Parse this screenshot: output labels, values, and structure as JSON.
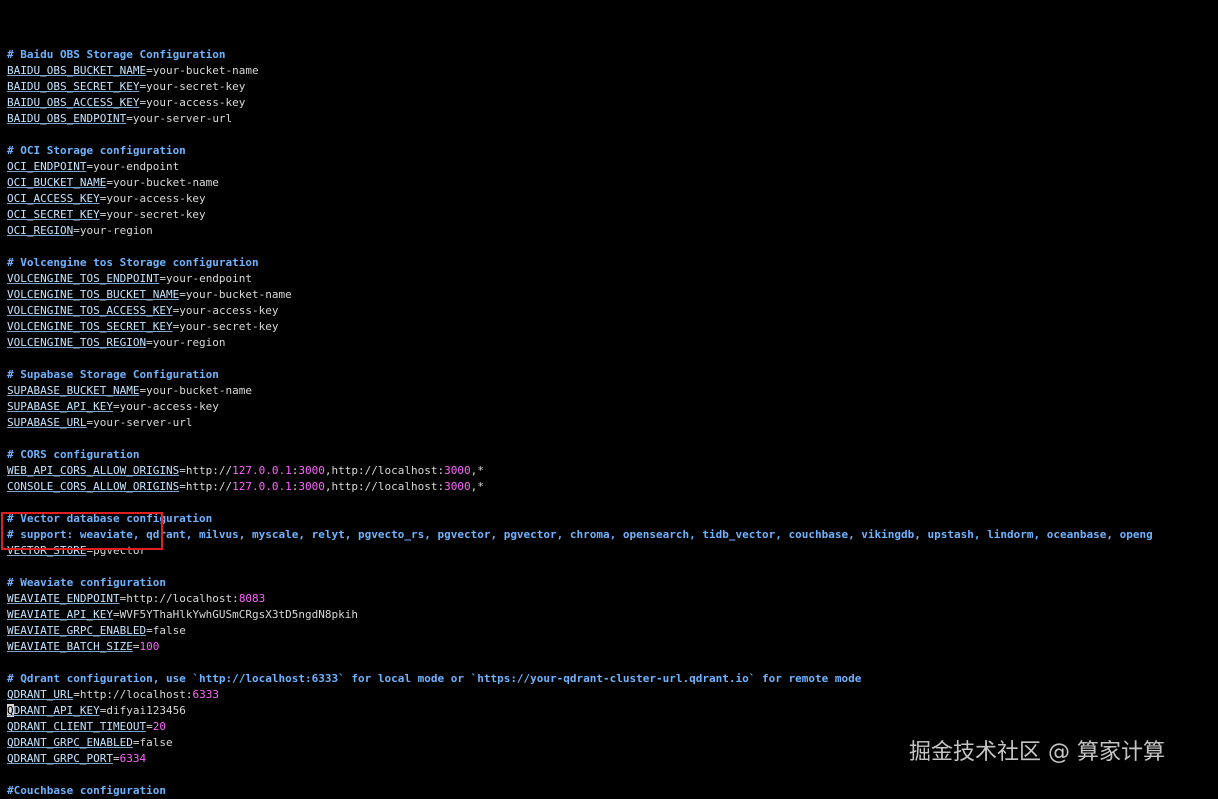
{
  "lines": [
    {
      "t": "blank"
    },
    {
      "t": "comment",
      "text": "# Baidu OBS Storage Configuration"
    },
    {
      "t": "kv",
      "key": "BAIDU_OBS_BUCKET_NAME",
      "parts": [
        {
          "v": "your-bucket-name"
        }
      ]
    },
    {
      "t": "kv",
      "key": "BAIDU_OBS_SECRET_KEY",
      "parts": [
        {
          "v": "your-secret-key"
        }
      ]
    },
    {
      "t": "kv",
      "key": "BAIDU_OBS_ACCESS_KEY",
      "parts": [
        {
          "v": "your-access-key"
        }
      ]
    },
    {
      "t": "kv",
      "key": "BAIDU_OBS_ENDPOINT",
      "parts": [
        {
          "v": "your-server-url"
        }
      ]
    },
    {
      "t": "blank"
    },
    {
      "t": "comment",
      "text": "# OCI Storage configuration"
    },
    {
      "t": "kv",
      "key": "OCI_ENDPOINT",
      "parts": [
        {
          "v": "your-endpoint"
        }
      ]
    },
    {
      "t": "kv",
      "key": "OCI_BUCKET_NAME",
      "parts": [
        {
          "v": "your-bucket-name"
        }
      ]
    },
    {
      "t": "kv",
      "key": "OCI_ACCESS_KEY",
      "parts": [
        {
          "v": "your-access-key"
        }
      ]
    },
    {
      "t": "kv",
      "key": "OCI_SECRET_KEY",
      "parts": [
        {
          "v": "your-secret-key"
        }
      ]
    },
    {
      "t": "kv",
      "key": "OCI_REGION",
      "parts": [
        {
          "v": "your-region"
        }
      ]
    },
    {
      "t": "blank"
    },
    {
      "t": "comment",
      "text": "# Volcengine tos Storage configuration"
    },
    {
      "t": "kv",
      "key": "VOLCENGINE_TOS_ENDPOINT",
      "parts": [
        {
          "v": "your-endpoint"
        }
      ]
    },
    {
      "t": "kv",
      "key": "VOLCENGINE_TOS_BUCKET_NAME",
      "parts": [
        {
          "v": "your-bucket-name"
        }
      ]
    },
    {
      "t": "kv",
      "key": "VOLCENGINE_TOS_ACCESS_KEY",
      "parts": [
        {
          "v": "your-access-key"
        }
      ]
    },
    {
      "t": "kv",
      "key": "VOLCENGINE_TOS_SECRET_KEY",
      "parts": [
        {
          "v": "your-secret-key"
        }
      ]
    },
    {
      "t": "kv",
      "key": "VOLCENGINE_TOS_REGION",
      "parts": [
        {
          "v": "your-region"
        }
      ]
    },
    {
      "t": "blank"
    },
    {
      "t": "comment",
      "text": "# Supabase Storage Configuration"
    },
    {
      "t": "kv",
      "key": "SUPABASE_BUCKET_NAME",
      "parts": [
        {
          "v": "your-bucket-name"
        }
      ]
    },
    {
      "t": "kv",
      "key": "SUPABASE_API_KEY",
      "parts": [
        {
          "v": "your-access-key"
        }
      ]
    },
    {
      "t": "kv",
      "key": "SUPABASE_URL",
      "parts": [
        {
          "v": "your-server-url"
        }
      ]
    },
    {
      "t": "blank"
    },
    {
      "t": "comment",
      "text": "# CORS configuration"
    },
    {
      "t": "kv",
      "key": "WEB_API_CORS_ALLOW_ORIGINS",
      "parts": [
        {
          "v": "http://"
        },
        {
          "v": "127.0.0.1",
          "n": true
        },
        {
          "v": ":"
        },
        {
          "v": "3000",
          "n": true
        },
        {
          "v": ",http://localhost:"
        },
        {
          "v": "3000",
          "n": true
        },
        {
          "v": ",*"
        }
      ]
    },
    {
      "t": "kv",
      "key": "CONSOLE_CORS_ALLOW_ORIGINS",
      "parts": [
        {
          "v": "http://"
        },
        {
          "v": "127.0.0.1",
          "n": true
        },
        {
          "v": ":"
        },
        {
          "v": "3000",
          "n": true
        },
        {
          "v": ",http://localhost:"
        },
        {
          "v": "3000",
          "n": true
        },
        {
          "v": ",*"
        }
      ]
    },
    {
      "t": "blank"
    },
    {
      "t": "comment",
      "text": "# Vector database configuration"
    },
    {
      "t": "comment",
      "text": "# support: weaviate, qdrant, milvus, myscale, relyt, pgvecto_rs, pgvector, pgvector, chroma, opensearch, tidb_vector, couchbase, vikingdb, upstash, lindorm, oceanbase, openg"
    },
    {
      "t": "kv",
      "key": "VECTOR_STORE",
      "parts": [
        {
          "v": "pgvector"
        }
      ]
    },
    {
      "t": "blank"
    },
    {
      "t": "comment",
      "text": "# Weaviate configuration"
    },
    {
      "t": "kv",
      "key": "WEAVIATE_ENDPOINT",
      "parts": [
        {
          "v": "http://localhost:"
        },
        {
          "v": "8083",
          "n": true
        }
      ]
    },
    {
      "t": "kv",
      "key": "WEAVIATE_API_KEY",
      "parts": [
        {
          "v": "WVF5YThaHlkYwhGUSmCRgsX3tD5ngdN8pkih"
        }
      ]
    },
    {
      "t": "kv",
      "key": "WEAVIATE_GRPC_ENABLED",
      "parts": [
        {
          "v": "false"
        }
      ]
    },
    {
      "t": "kv",
      "key": "WEAVIATE_BATCH_SIZE",
      "parts": [
        {
          "v": "100",
          "n": true
        }
      ]
    },
    {
      "t": "blank"
    },
    {
      "t": "comment",
      "text": "# Qdrant configuration, use `http://localhost:6333` for local mode or `https://your-qdrant-cluster-url.qdrant.io` for remote mode"
    },
    {
      "t": "kv",
      "key": "QDRANT_URL",
      "parts": [
        {
          "v": "http://localhost:"
        },
        {
          "v": "6333",
          "n": true
        }
      ]
    },
    {
      "t": "kv",
      "key": "QDRANT_API_KEY",
      "cursor": true,
      "parts": [
        {
          "v": "difyai123456"
        }
      ]
    },
    {
      "t": "kv",
      "key": "QDRANT_CLIENT_TIMEOUT",
      "parts": [
        {
          "v": "20",
          "n": true
        }
      ]
    },
    {
      "t": "kv",
      "key": "QDRANT_GRPC_ENABLED",
      "parts": [
        {
          "v": "false"
        }
      ]
    },
    {
      "t": "kv",
      "key": "QDRANT_GRPC_PORT",
      "parts": [
        {
          "v": "6334",
          "n": true
        }
      ]
    },
    {
      "t": "blank"
    },
    {
      "t": "comment",
      "text": "#Couchbase configuration"
    }
  ],
  "watermark": "掘金技术社区 @ 算家计算",
  "colors": {
    "background": "#000000",
    "comment": "#6fb3ff",
    "key": "#c4e4ff",
    "value": "#d8d8d8",
    "number": "#ff66ff",
    "highlight_box": "#e02020"
  }
}
